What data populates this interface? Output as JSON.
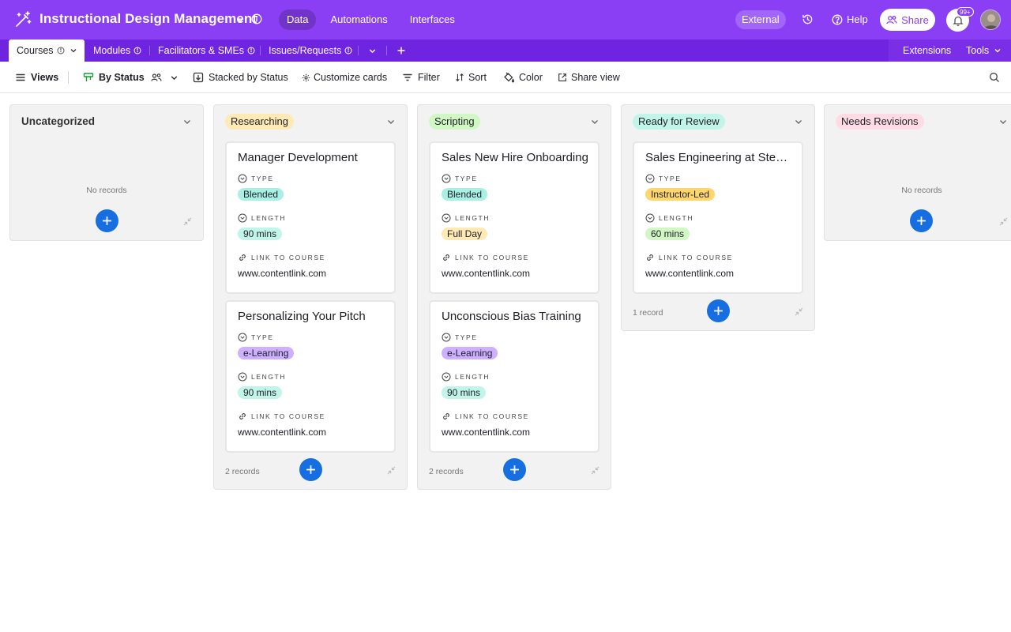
{
  "app": {
    "title": "Instructional Design Management",
    "nav": [
      "Data",
      "Automations",
      "Interfaces"
    ],
    "external_label": "External",
    "help_label": "Help",
    "share_label": "Share",
    "notif_count": "99+"
  },
  "tables": {
    "tabs": [
      "Courses",
      "Modules",
      "Facilitators & SMEs",
      "Issues/Requests"
    ],
    "extensions_label": "Extensions",
    "tools_label": "Tools"
  },
  "toolbar": {
    "views_label": "Views",
    "view_name": "By Status",
    "stacked_label": "Stacked by Status",
    "customize_label": "Customize cards",
    "filter_label": "Filter",
    "sort_label": "Sort",
    "color_label": "Color",
    "share_view_label": "Share view"
  },
  "labels": {
    "type": "TYPE",
    "length": "LENGTH",
    "link": "LINK TO COURSE",
    "no_records": "No records"
  },
  "colors": {
    "brand": "#8a3ff5",
    "researching": "#ffeab6",
    "scripting": "#d1f7c4",
    "ready": "#c2f5e9",
    "needs_revisions": "#ffdce5",
    "blended": "#a8f0e4",
    "elearning": "#cdb0ff",
    "instructor_led": "#ffd66e",
    "length_green": "#d1f7c4",
    "length_teal": "#c2f5e9",
    "fullday": "#ffeab6"
  },
  "stacks": [
    {
      "name": "Uncategorized",
      "count_label": ""
    },
    {
      "name": "Researching",
      "count_label": "2 records"
    },
    {
      "name": "Scripting",
      "count_label": "2 records"
    },
    {
      "name": "Ready for Review",
      "count_label": "1 record"
    },
    {
      "name": "Needs Revisions",
      "count_label": ""
    }
  ],
  "cards": [
    {
      "title": "Manager Development",
      "type": "Blended",
      "length": "90 mins",
      "link": "www.contentlink.com"
    },
    {
      "title": "Personalizing Your Pitch",
      "type": "e-Learning",
      "length": "90 mins",
      "link": "www.contentlink.com"
    },
    {
      "title": "Sales New Hire Onboarding",
      "type": "Blended",
      "length": "Full Day",
      "link": "www.contentlink.com"
    },
    {
      "title": "Unconscious Bias Training",
      "type": "e-Learning",
      "length": "90 mins",
      "link": "www.contentlink.com"
    },
    {
      "title": "Sales Engineering at Stemline Corp",
      "type": "Instructor-Led",
      "length": "60 mins",
      "link": "www.contentlink.com"
    }
  ]
}
